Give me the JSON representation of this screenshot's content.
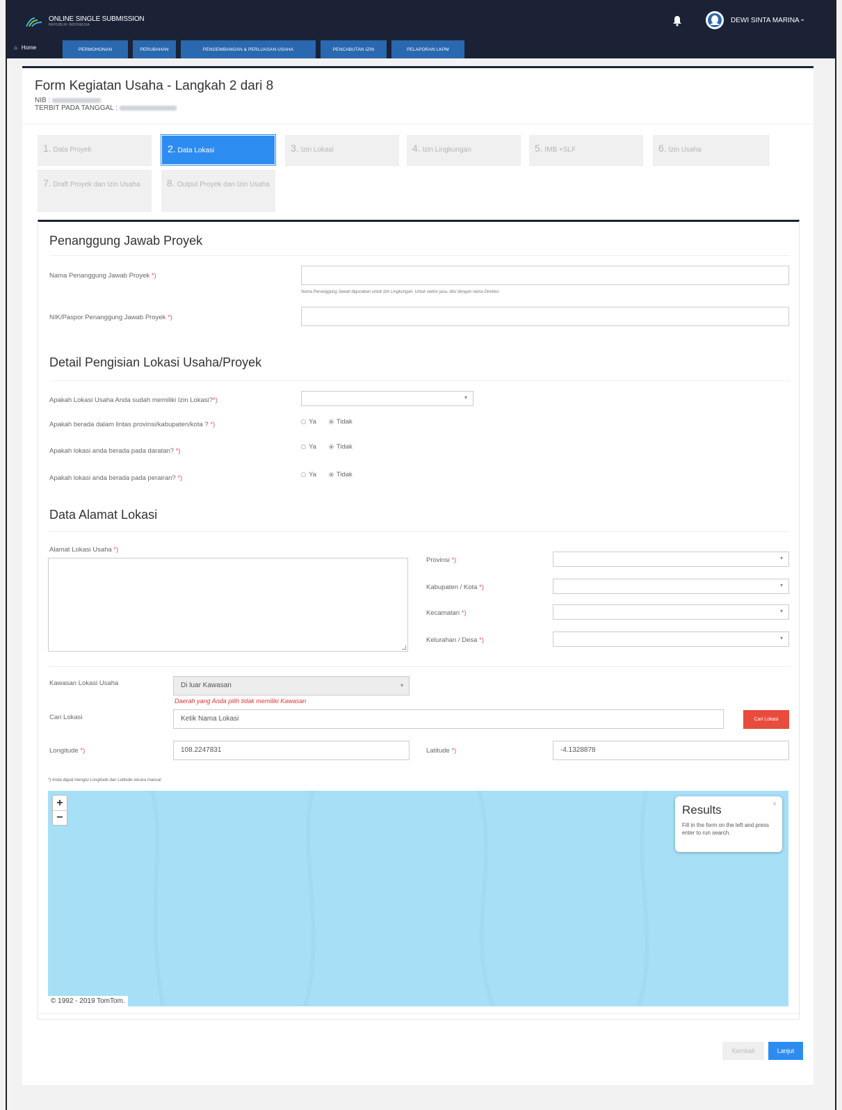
{
  "header": {
    "brand_title": "ONLINE SINGLE SUBMISSION",
    "brand_subtitle": "REPUBLIK INDONESIA",
    "username": "DEWI SINTA MARINA"
  },
  "nav": {
    "home": "Home",
    "tabs": [
      "PERMOHONAN",
      "PERUBAHAN",
      "PENGEMBANGAN & PERLUASAN USAHA",
      "PENCABUTAN IZIN",
      "PELAPORAN LKPM"
    ]
  },
  "page": {
    "title": "Form Kegiatan Usaha - Langkah 2 dari 8",
    "nib_label": "NIB :",
    "terbit_label": "TERBIT PADA TANGGAL :"
  },
  "steps": [
    {
      "num": "1.",
      "label": "Data Proyek"
    },
    {
      "num": "2.",
      "label": "Data Lokasi"
    },
    {
      "num": "3.",
      "label": "Izin Lokasi"
    },
    {
      "num": "4.",
      "label": "Izin Lingkungan"
    },
    {
      "num": "5.",
      "label": "IMB +SLF"
    },
    {
      "num": "6.",
      "label": "Izin Usaha"
    },
    {
      "num": "7.",
      "label": "Draft Proyek dan Izin Usaha"
    },
    {
      "num": "8.",
      "label": "Output Proyek dan Izin Usaha"
    }
  ],
  "pj": {
    "section": "Penanggung Jawab Proyek",
    "nama_label": "Nama Penanggung Jawab Proyek",
    "nama_help": "Nama Penanggung Jawab digunakan untuk Izin Lingkungan. Untuk sektor jasa, diisi dengan nama Direktur.",
    "nik_label": "NIK/Paspor Penanggung Jawab Proyek"
  },
  "detail": {
    "section": "Detail Pengisian Lokasi Usaha/Proyek",
    "q1": "Apakah Lokasi Usaha Anda sudah memiliki Izin Lokasi?",
    "q2": "Apakah berada dalam lintas provinsi/kabupaten/kota ?",
    "q3": "Apakah lokasi anda berada pada daratan?",
    "q4": "Apakah lokasi anda berada pada perairan?",
    "ya": "Ya",
    "tidak": "Tidak",
    "required_mark": "*)"
  },
  "alamat": {
    "section": "Data Alamat Lokasi",
    "alamat_label": "Alamat Lokasi Usaha",
    "provinsi": "Provinsi",
    "kabupaten": "Kabupaten / Kota",
    "kecamatan": "Kecamatan",
    "kelurahan": "Kelurahan / Desa",
    "kawasan_label": "Kawasan Lokasi Usaha",
    "kawasan_value": "Di luar Kawasan",
    "kawasan_note": "Daerah yang Anda pilih tidak memiliki Kawasan",
    "cari_label": "Cari Lokasi",
    "cari_placeholder": "Ketik Nama Lokasi",
    "cari_button": "Cari Lokasi",
    "longitude_label": "Longitude",
    "longitude_value": "108.2247831",
    "latitude_label": "Latitude",
    "latitude_value": "-4.1328878",
    "manual_note": "*) Anda dapat mengisi Longitude dan Latitude secara manual"
  },
  "map": {
    "zoom_in": "+",
    "zoom_out": "−",
    "results_title": "Results",
    "results_body": "Fill in the form on the left and press enter to run search.",
    "results_close": "×",
    "copyright": "© 1992 - 2019 TomTom."
  },
  "footer": {
    "kembali": "Kembali",
    "lanjut": "Lanjut"
  },
  "colors": {
    "navy": "#1b2236",
    "tab_blue": "#2a68b0",
    "active_step": "#2d8cf0",
    "danger": "#e74c3c",
    "map_water": "#a6dff6"
  }
}
